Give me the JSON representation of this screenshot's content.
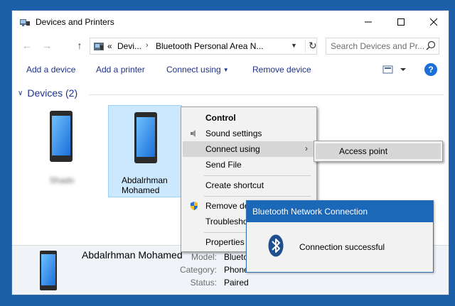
{
  "window": {
    "title": "Devices and Printers"
  },
  "address": {
    "prefix": "«",
    "crumbs": [
      "Devi...",
      "Bluetooth Personal Area N..."
    ],
    "search_placeholder": "Search Devices and Pr..."
  },
  "toolbar": {
    "add_device": "Add a device",
    "add_printer": "Add a printer",
    "connect_using": "Connect using",
    "remove_device": "Remove device"
  },
  "section": {
    "label": "Devices (2)"
  },
  "devices": [
    {
      "name": "Shado"
    },
    {
      "name": "Abdalrhman Mohamed"
    }
  ],
  "details": {
    "device_name": "Abdalrhman Mohamed",
    "fields": [
      {
        "key": "Model:",
        "value": "Blueto"
      },
      {
        "key": "Category:",
        "value": "Phone"
      },
      {
        "key": "Status:",
        "value": "Paired"
      }
    ]
  },
  "context_menu": {
    "items": [
      "Control",
      "Sound settings",
      "Connect using",
      "Send File",
      "Create shortcut",
      "Remove de",
      "Troublesho",
      "Properties"
    ]
  },
  "submenu": {
    "items": [
      "Access point"
    ]
  },
  "toast": {
    "title": "Bluetooth Network Connection",
    "message": "Connection successful"
  },
  "colors": {
    "accent": "#1c68b8",
    "link": "#1e3287",
    "selection": "#cce8ff",
    "desktop": "#1a5fa8"
  }
}
